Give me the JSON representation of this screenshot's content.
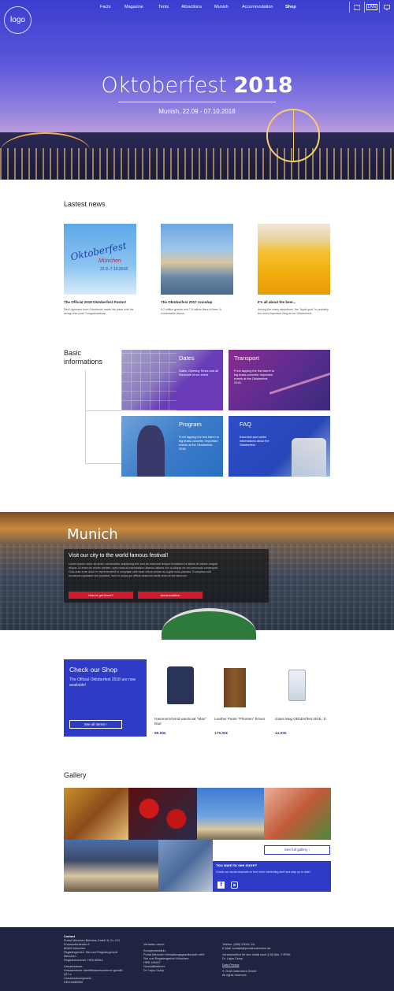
{
  "header": {
    "logo": "logo",
    "nav": [
      "Facts",
      "Magazine",
      "Tents",
      "Attractions",
      "Munish",
      "Accommodation",
      "Shop"
    ],
    "icons": [
      "map-icon",
      "language-icon",
      "monitor-icon"
    ],
    "lang_label": "LIVE",
    "hero_title_light": "Oktoberfest ",
    "hero_title_bold": "2018",
    "hero_subtitle": "Munish, 22.09 - 07.10.2018"
  },
  "news": {
    "heading": "Lastest news",
    "items": [
      {
        "title": "The Official 2018 Oktoberfest Poster!",
        "text": "Dirk Lippmann from Dürwbrook made the place with his design this year! Congratulations!",
        "img_text_1": "Oktoberfest",
        "img_text_2": "München",
        "img_text_3": "22.9.-7.10.2018"
      },
      {
        "title": "The Oktoberfest 2017 roundup",
        "text": "6.2 million guests and 7.5 million liters of beer: A comfortable Wiesn.",
        "img_text_1": "",
        "img_text_2": "",
        "img_text_3": ""
      },
      {
        "title": "It's all about the beer...",
        "text": "Among the many attractions, the \"liquid gold\" is probably the most important thing at the Oktoberfest.",
        "img_text_1": "",
        "img_text_2": "",
        "img_text_3": ""
      }
    ]
  },
  "info": {
    "heading_1": "Basic",
    "heading_2": "informations",
    "tiles": [
      {
        "title": "Dates",
        "text": "Dates, Opening Times and all Schedule of our event.",
        "color": "#6a3bb8"
      },
      {
        "title": "Transport",
        "text": "From tapping the first barrel to big brass-concerts: important events at the Oktoberfest 2018.",
        "color": "#8a2b8f"
      },
      {
        "title": "Program",
        "text": "From tapping the first barrel to big brass-concerts: Important events at the Oktoberfest 2018.",
        "color": "#2a6fc2"
      },
      {
        "title": "FAQ",
        "text": "Essential and useful informations about the Oktoberfest.",
        "color": "#2e4ec9"
      }
    ]
  },
  "munich": {
    "title": "Munich",
    "panel_title": "Visit our city to the world famous festival!",
    "panel_text": "Lorem ipsum dolor sit amet, consectetur adipiscing elit, sed do eiusmod tempor incididunt ut labore et dolore magna aliqua. Ut enim ad minim veniam, quis nostrud exercitation ullamco laboris nisi ut aliquip ex ea commodo consequat. Duis aute irure dolor in reprehenderit in voluptate velit esse cillum dolore eu fugiat nulla pariatur. Excepteur sint occaecat cupidatat non proident, sunt in culpa qui officia deserunt mollit anim id est laborum.",
    "button_1": "How to get there?",
    "button_2": "Accomodation"
  },
  "shop": {
    "title": "Check our Shop",
    "text": "The Official Oktoberfest 2018 are now available!",
    "button": "See all items!",
    "products": [
      {
        "name": "Hammerschmid waistcoat \"Max\" blue",
        "price": "89.95€"
      },
      {
        "name": "Leather Pants \"Pfronten\" brown",
        "price": "179.00€"
      },
      {
        "name": "Glass Mug Oktoberfest 2018, 1l",
        "price": "14.00€"
      }
    ]
  },
  "gallery": {
    "heading": "Gallery",
    "button": "See full gallery",
    "social_title": "You want to see more?",
    "social_text": "Check our social channels to find more interesting stuff and stay up to date!"
  },
  "footer": {
    "col1": [
      "Contact",
      "",
      "Portal München Betriebs-GmbH & Co. KG",
      "Fraunhoferstraße 6",
      "80469 München",
      "Registergericht: Sitz und Registergericht München",
      "Registernummer: HRA 80544",
      "",
      "Umsatzsteuer:",
      "Umsatzsteuer-Identifikationsnummer gemäß §27 a",
      "Umsatzsteuergesetz:",
      "DE204880050"
    ],
    "col2": [
      "Vertreten durch:",
      "",
      "Komplementärin:",
      "Portal München Verwaltungsgesellschaft mbH",
      "Sitz und Registergericht München:",
      "HRB 144697",
      "Geschäftsführer:",
      "Dr. Lajos Csery"
    ],
    "col3": [
      "Telefon: (089) 23001-111",
      "E-Mail: kontakt@portalmuenchen.de",
      "",
      "Verantwortlich für den Inhalt nach § 55 Abs. 2 RStV:",
      "Dr. Lajos Csery",
      "",
      "Data Privacy",
      "",
      "© 2018 Datenwerk GmbH",
      "All rights reserved."
    ]
  }
}
